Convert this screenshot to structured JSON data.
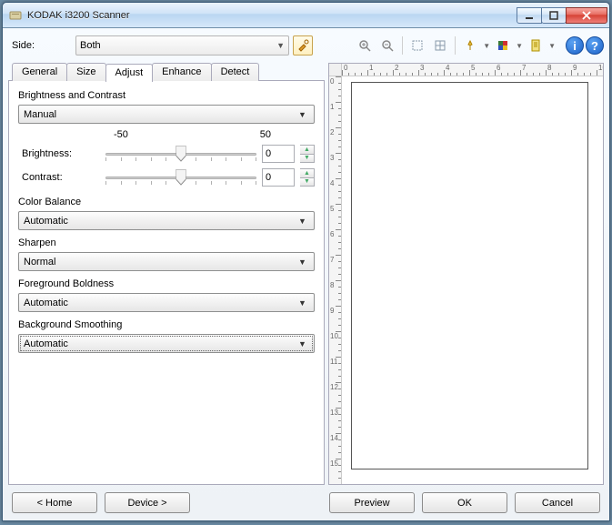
{
  "window": {
    "title": "KODAK i3200 Scanner"
  },
  "toolbar": {
    "side_label": "Side:",
    "side_value": "Both"
  },
  "tabs": [
    "General",
    "Size",
    "Adjust",
    "Enhance",
    "Detect"
  ],
  "adjust": {
    "brightness_contrast_label": "Brightness and Contrast",
    "brightness_contrast_mode": "Manual",
    "scale_min": "-50",
    "scale_max": "50",
    "brightness_label": "Brightness:",
    "brightness_value": "0",
    "contrast_label": "Contrast:",
    "contrast_value": "0",
    "color_balance_label": "Color Balance",
    "color_balance_value": "Automatic",
    "sharpen_label": "Sharpen",
    "sharpen_value": "Normal",
    "foreground_label": "Foreground Boldness",
    "foreground_value": "Automatic",
    "background_label": "Background Smoothing",
    "background_value": "Automatic"
  },
  "footer": {
    "home": "< Home",
    "device": "Device >",
    "preview": "Preview",
    "ok": "OK",
    "cancel": "Cancel"
  }
}
